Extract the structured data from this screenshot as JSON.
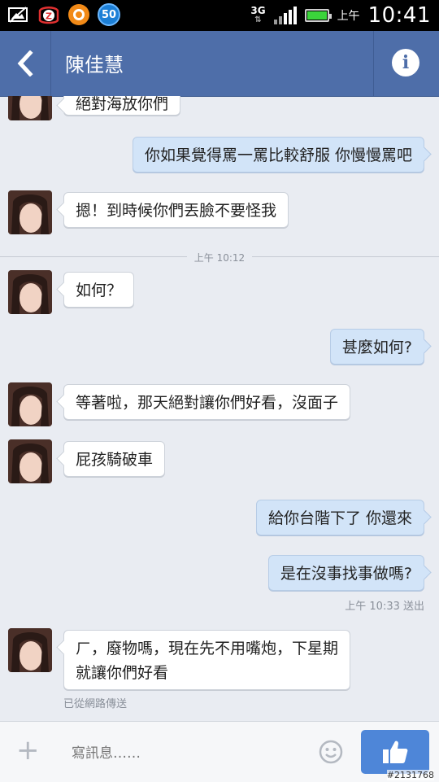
{
  "status_bar": {
    "badge_count": "50",
    "network": "3G",
    "ampm": "上午",
    "clock": "10:41"
  },
  "header": {
    "title": "陳佳慧",
    "info_glyph": "i"
  },
  "chat": {
    "partial_top_message": "絕對海放你們",
    "messages": [
      {
        "side": "out",
        "text": "你如果覺得罵一罵比較舒服 你慢慢罵吧"
      },
      {
        "side": "in",
        "text": "摁！到時候你們丟臉不要怪我"
      },
      {
        "side": "in",
        "text": "如何？"
      },
      {
        "side": "out",
        "text": "甚麼如何?"
      },
      {
        "side": "in",
        "text": "等著啦，那天絕對讓你們好看，沒面子"
      },
      {
        "side": "in",
        "text": "屁孩騎破車"
      },
      {
        "side": "out",
        "text": "給你台階下了 你還來"
      },
      {
        "side": "out",
        "text": "是在沒事找事做嗎?"
      },
      {
        "side": "in",
        "text_line1": "ㄏ，廢物嗎，現在先不用嘴炮，下星期",
        "text_line2": "就讓你們好看"
      }
    ],
    "time_separator": "上午 10:12",
    "sent_status": "上午 10:33 送出",
    "via_web": "已從網路傳送"
  },
  "input_bar": {
    "placeholder": "寫訊息……",
    "plus_glyph": "+"
  },
  "watermark": "#2131768",
  "colors": {
    "header": "#4e6ea9",
    "outgoing_bubble": "#d2e4f8",
    "incoming_bubble": "#ffffff",
    "like_button": "#4e86d8"
  }
}
